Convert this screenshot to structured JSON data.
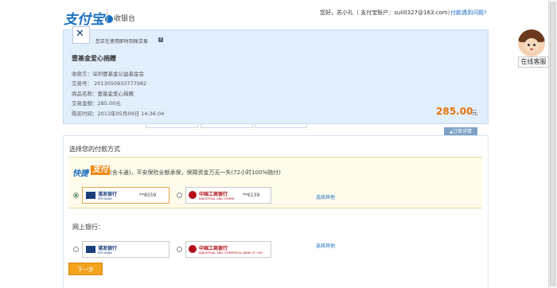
{
  "header": {
    "logo_text": "支付宝",
    "title": "收银台",
    "user_info": "您好，苏小礼（ 支付宝账户：suli0327@163.com）",
    "help_link": "付款遇到问题?"
  },
  "online_service": {
    "label": "在线客服"
  },
  "order": {
    "using_notice": "您正在使用即时到账交易",
    "notice_icon": "?",
    "title": "壹基金爱心捐赠",
    "recipient": "收款方：深圳壹基金公益基金会",
    "trade_no": "交易号：  2013050933777982",
    "product_name": "商品名称：壹基金爱心捐赠",
    "trade_amount": "交易金额：285.00元",
    "purchase_time": "购买时间：2013年05月09日 14:36:04",
    "amount": "285.00",
    "amount_unit": "元",
    "detail_button": "订单详情"
  },
  "payment": {
    "choose_label": "选择您的付款方式",
    "express_logo_a": "快捷",
    "express_logo_b": "支付",
    "express_desc": "(含卡通)，平安保险全额承保，保障资金万无一失(72小时100%赔付)",
    "express_cards": [
      {
        "bank": "浦发银行",
        "bank_sub": "SPD BANK",
        "tail": "**8559",
        "color": "#1a3f7a",
        "selected": true
      },
      {
        "bank": "中国工商银行",
        "bank_sub": "INDUSTRIAL AND COMMERCIAL BANK OF CHINA",
        "tail": "**6139",
        "color": "#b0101a",
        "selected": false
      }
    ],
    "select_other": "选择其他",
    "online_bank_label": "网上银行：",
    "online_banks": [
      {
        "bank": "浦发银行",
        "bank_sub": "SPD BANK",
        "color": "#1a3f7a"
      },
      {
        "bank": "中国工商银行",
        "bank_sub": "INDUSTRIAL AND COMMERCIAL BANK OF CHINA",
        "color": "#b0101a"
      }
    ],
    "next_button": "下一步"
  },
  "colors": {
    "accent_blue": "#1a6fc0",
    "amount_orange": "#e5760b",
    "button_orange": "#f3a21e"
  }
}
